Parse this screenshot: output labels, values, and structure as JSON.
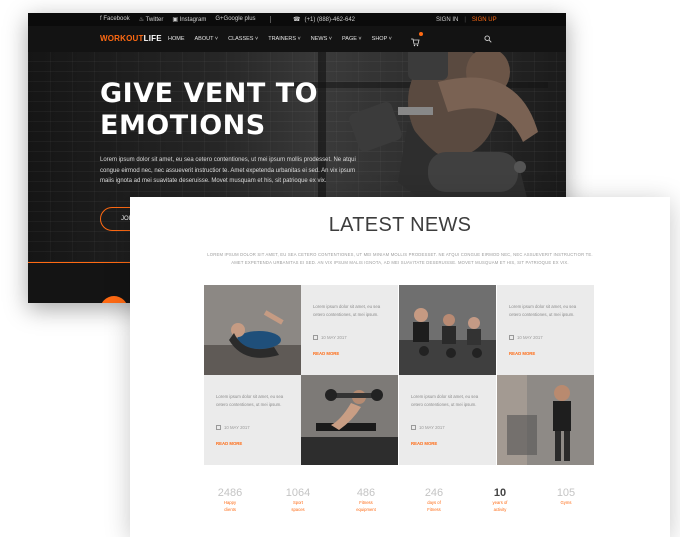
{
  "colors": {
    "accent": "#ff6a13",
    "dark": "#111111",
    "light_cell": "#ebebeb"
  },
  "topbar": {
    "social": [
      "Facebook",
      "Twitter",
      "Instagram",
      "Google plus"
    ],
    "phone": "(+1) (888)-462-642",
    "signin": "SIGN IN",
    "signup": "SIGN UP"
  },
  "nav": {
    "logo_a": "WORKOUT",
    "logo_b": "LIFE",
    "items": [
      "HOME",
      "ABOUT ˅",
      "CLASSES ˅",
      "TRAINERS ˅",
      "NEWS ˅",
      "PAGE ˅",
      "SHOP ˅"
    ]
  },
  "hero": {
    "title_line1": "GIVE VENT TO",
    "title_line2": "EMOTIONS",
    "text": "Lorem ipsum dolor sit amet, eu sea cetero contentiones, ut mei ipsum mollis prodesset. Ne atqui congue eirmod nec, nec assueverit instructior te. Amet expetenda urbanitas ei sed. An vix ipsum maiis ignota ad mei suavitate deseruisse. Movet musquam et his, sit patrioque ex vix.",
    "button": "JOIN"
  },
  "news": {
    "title": "LATEST NEWS",
    "subtitle": "LOREM IPSUM DOLOR SIT AMET, EU SEA CETERO CONTENTIONES, UT MEI MINIAM MOLLIS PRODESSET. NE ATQUI CONGUE EIRMOD NEC, NEC ASSUEVERIT INSTRUCTIOR TE. AMET EXPETENDA URBANITAS EI SED. AN VIX IPSUM MALIS IGNOTA, AD MEI SUAVITATE DESERUISSE. MOVET MUSQUAM ET HIS, SIT PATRIOQUE EX VIX.",
    "cards": [
      {
        "text": "Lorem ipsum dolor sit amet, eu sea cetero contentiones, ut mei ipsum.",
        "date": "10 MAY 2017",
        "more": "READ MORE"
      },
      {
        "text": "Lorem ipsum dolor sit amet, eu sea cetero contentiones, ut mei ipsum.",
        "date": "10 MAY 2017",
        "more": "READ MORE"
      },
      {
        "text": "Lorem ipsum dolor sit amet, eu sea cetero contentiones, ut mei ipsum.",
        "date": "10 MAY 2017",
        "more": "READ MORE"
      },
      {
        "text": "Lorem ipsum dolor sit amet, eu sea cetero contentiones, ut mei ipsum.",
        "date": "10 MAY 2017",
        "more": "READ MORE"
      }
    ]
  },
  "stats": [
    {
      "num": "2486",
      "label1": "Happy",
      "label2": "clients"
    },
    {
      "num": "1064",
      "label1": "Sport",
      "label2": "spaces"
    },
    {
      "num": "486",
      "label1": "Fitness",
      "label2": "equipment"
    },
    {
      "num": "246",
      "label1": "days of",
      "label2": "Fitness"
    },
    {
      "num": "10",
      "label1": "years of",
      "label2": "activity"
    },
    {
      "num": "105",
      "label1": "Gyms",
      "label2": ""
    }
  ]
}
